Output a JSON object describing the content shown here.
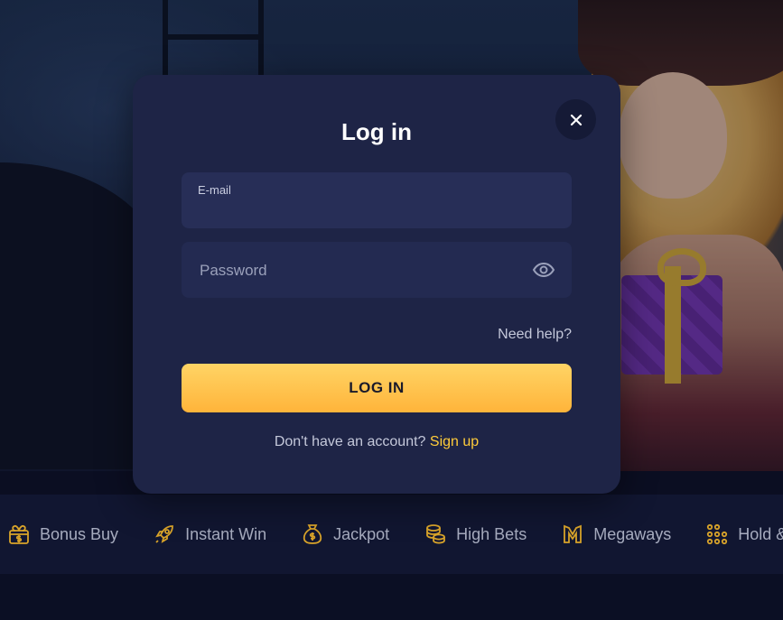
{
  "modal": {
    "title": "Log in",
    "email": {
      "label": "E-mail",
      "value": ""
    },
    "password": {
      "placeholder": "Password",
      "value": ""
    },
    "need_help": "Need help?",
    "login_button": "LOG IN",
    "signup_prompt": "Don't have an account?",
    "signup_link": "Sign up"
  },
  "categories": [
    {
      "label": "Bonus Buy",
      "icon": "gift-dollar-icon"
    },
    {
      "label": "Instant Win",
      "icon": "rocket-icon"
    },
    {
      "label": "Jackpot",
      "icon": "money-bag-icon"
    },
    {
      "label": "High Bets",
      "icon": "coin-stack-icon"
    },
    {
      "label": "Megaways",
      "icon": "megaways-m-icon"
    },
    {
      "label": "Hold &",
      "icon": "dots-grid-icon"
    }
  ],
  "colors": {
    "accent": "#ffcc3a",
    "modal_bg": "#1e2446",
    "button_gradient_top": "#ffd465",
    "button_gradient_bottom": "#ffb43a",
    "category_icon": "#d9a42a"
  }
}
